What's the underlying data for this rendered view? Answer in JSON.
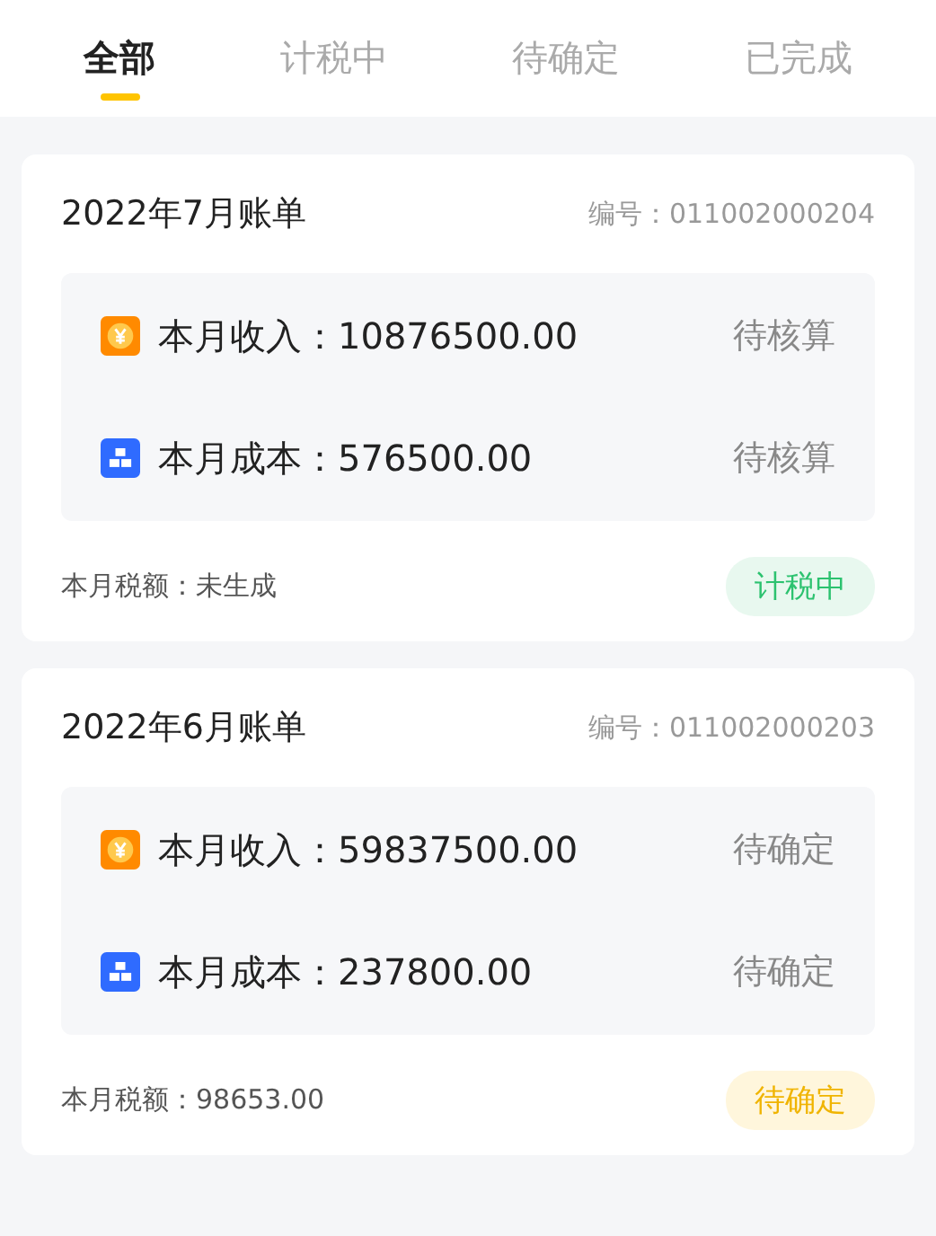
{
  "tabs": [
    {
      "label": "全部",
      "selected": true
    },
    {
      "label": "计税中",
      "selected": false
    },
    {
      "label": "待确定",
      "selected": false
    },
    {
      "label": "已完成",
      "selected": false
    }
  ],
  "bills": [
    {
      "title": "2022年7月账单",
      "number_label": "编号：",
      "number": "011002000204",
      "items": [
        {
          "kind": "income",
          "label": "本月收入：",
          "amount": "10876500.00",
          "status": "待核算"
        },
        {
          "kind": "cost",
          "label": "本月成本：",
          "amount": "576500.00",
          "status": "待核算"
        }
      ],
      "tax_label": "本月税额：",
      "tax": "未生成",
      "badge": {
        "kind": "taxing",
        "text": "计税中"
      }
    },
    {
      "title": "2022年6月账单",
      "number_label": "编号：",
      "number": "011002000203",
      "items": [
        {
          "kind": "income",
          "label": "本月收入：",
          "amount": "59837500.00",
          "status": "待确定"
        },
        {
          "kind": "cost",
          "label": "本月成本：",
          "amount": "237800.00",
          "status": "待确定"
        }
      ],
      "tax_label": "本月税额：",
      "tax": "98653.00",
      "badge": {
        "kind": "pending",
        "text": "待确定"
      }
    }
  ]
}
